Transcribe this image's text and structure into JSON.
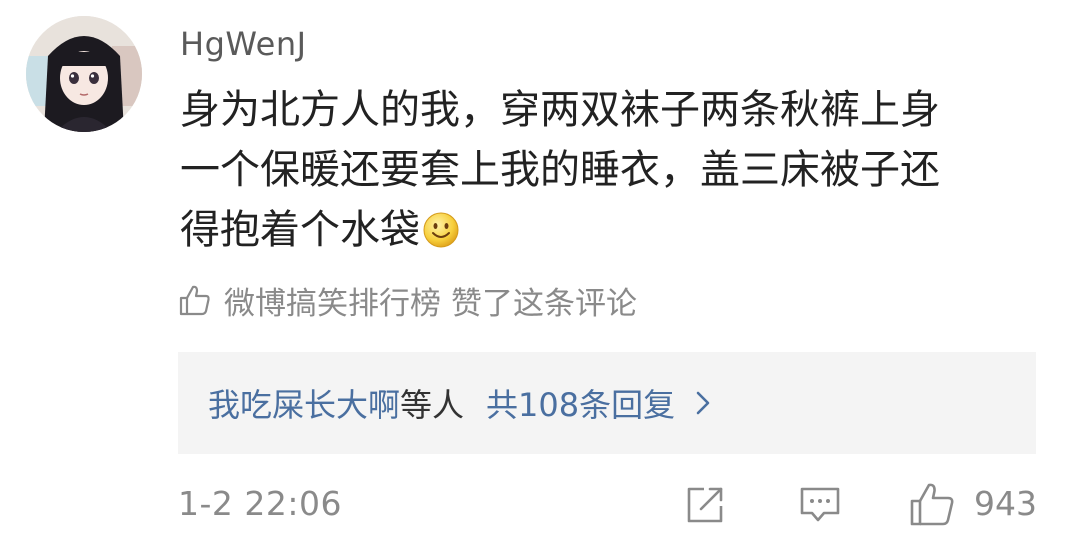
{
  "comment": {
    "username": "HgWenJ",
    "text_lines": [
      "身为北方人的我，穿两双袜子两条秋裤上身",
      "一个保暖还要套上我的睡衣，盖三床被子还",
      "得抱着个水袋"
    ],
    "emoji": "smile-emoji",
    "liked_by": {
      "name": "微博搞笑排行榜",
      "text": "赞了这条评论"
    },
    "replies": {
      "replier": "我吃屎长大啊",
      "suffix": "等人",
      "total": "共108条回复"
    },
    "timestamp": "1-2 22:06",
    "like_count": "943"
  },
  "icons": {
    "liked_by": "thumbs-up-icon",
    "replies_more": "chevron-right-icon",
    "repost": "repost-icon",
    "comment": "comment-icon",
    "like": "thumbs-up-icon"
  },
  "colors": {
    "link": "#4a6fa0",
    "meta": "#8a8a8a",
    "body": "#222222",
    "reply_bg": "#f4f4f4"
  }
}
